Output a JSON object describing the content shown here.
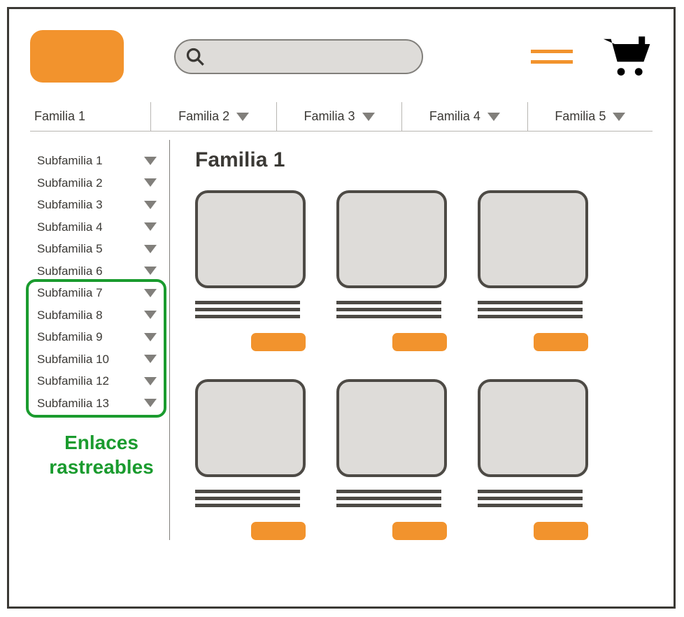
{
  "nav": [
    {
      "label": "Familia 1",
      "dropdown": false
    },
    {
      "label": "Familia 2",
      "dropdown": true
    },
    {
      "label": "Familia 3",
      "dropdown": true
    },
    {
      "label": "Familia 4",
      "dropdown": true
    },
    {
      "label": "Familia 5",
      "dropdown": true
    }
  ],
  "sidebar": [
    {
      "label": "Subfamilia 1"
    },
    {
      "label": "Subfamilia 2"
    },
    {
      "label": "Subfamilia 3"
    },
    {
      "label": "Subfamilia 4"
    },
    {
      "label": "Subfamilia 5"
    },
    {
      "label": "Subfamilia 6"
    },
    {
      "label": "Subfamilia 7"
    },
    {
      "label": "Subfamilia 8"
    },
    {
      "label": "Subfamilia 9"
    },
    {
      "label": "Subfamilia 10"
    },
    {
      "label": "Subfamilia 12"
    },
    {
      "label": "Subfamilia 13"
    }
  ],
  "highlight": {
    "startIndex": 6,
    "endIndex": 11
  },
  "annotation": "Enlaces rastreables",
  "pageTitle": "Familia 1",
  "productCount": 6,
  "colors": {
    "accent": "#f2932d",
    "highlight": "#1a9b2e"
  }
}
